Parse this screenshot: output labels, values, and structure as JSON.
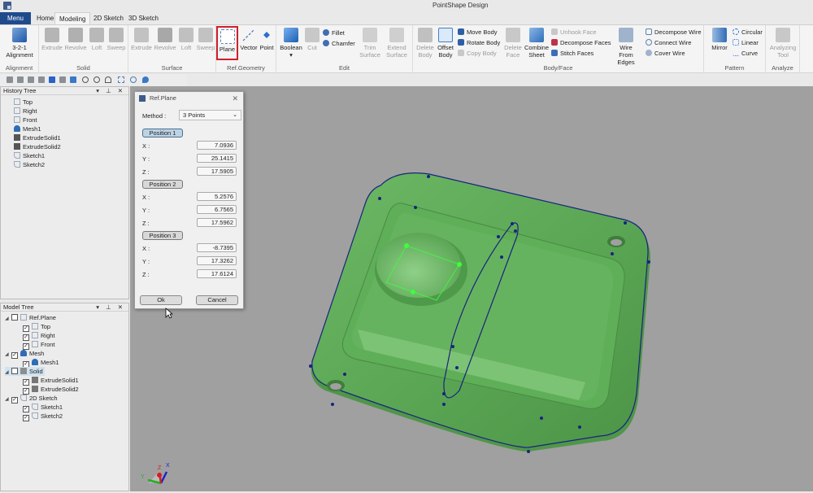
{
  "app": {
    "title": "PointShape Design"
  },
  "tabs": [
    {
      "label": "Menu"
    },
    {
      "label": "Home"
    },
    {
      "label": "Modeling",
      "active": true
    },
    {
      "label": "2D Sketch"
    },
    {
      "label": "3D Sketch"
    }
  ],
  "ribbon": {
    "groups": {
      "alignment": {
        "label": "Alignment",
        "btn": "3-2-1 Alignment"
      },
      "solid": {
        "label": "Solid",
        "items": [
          "Extrude",
          "Revolve",
          "Loft",
          "Sweep"
        ]
      },
      "surface": {
        "label": "Surface",
        "items": [
          "Extrude",
          "Revolve",
          "Loft",
          "Sweep"
        ]
      },
      "refgeom": {
        "label": "Ref.Geometry",
        "items": [
          "Plane",
          "Vector",
          "Point"
        ],
        "selected": "Plane"
      },
      "edit": {
        "label": "Edit",
        "boolean": "Boolean",
        "cut": "Cut",
        "fillet": "Fillet",
        "chamfer": "Chamfer",
        "trim": "Trim Surface",
        "extend": "Extend Surface"
      },
      "bodyface": {
        "label": "Body/Face",
        "delete_body": "Delete Body",
        "offset_body": "Offset Body",
        "move_body": "Move Body",
        "rotate_body": "Rotate Body",
        "copy_body": "Copy Body",
        "delete_face": "Delete Face",
        "combine_sheet": "Combine Sheet",
        "unhook_face": "Unhook Face",
        "decompose_faces": "Decompose Faces",
        "stitch_faces": "Stitch Faces",
        "wire_from_edges": "Wire From Edges",
        "decompose_wire": "Decompose Wire",
        "connect_wire": "Connect Wire",
        "cover_wire": "Cover Wire"
      },
      "pattern": {
        "label": "Pattern",
        "mirror": "Mirror",
        "circular": "Circular",
        "linear": "Linear",
        "curve": "Curve"
      },
      "analyze": {
        "label": "Analyze",
        "tool": "Analyzing Tool"
      }
    }
  },
  "history_tree": {
    "title": "History Tree",
    "items": [
      {
        "label": "Top",
        "icon": "plane-icon"
      },
      {
        "label": "Right",
        "icon": "plane-icon"
      },
      {
        "label": "Front",
        "icon": "plane-icon"
      },
      {
        "label": "Mesh1",
        "icon": "mesh-icon"
      },
      {
        "label": "ExtrudeSolid1",
        "icon": "solid-icon"
      },
      {
        "label": "ExtrudeSolid2",
        "icon": "solid-icon"
      },
      {
        "label": "Sketch1",
        "icon": "sketch-icon"
      },
      {
        "label": "Sketch2",
        "icon": "sketch-icon"
      }
    ]
  },
  "model_tree": {
    "title": "Model Tree",
    "items": [
      {
        "label": "Ref.Plane",
        "level": 0,
        "checked": false
      },
      {
        "label": "Top",
        "level": 1,
        "checked": true
      },
      {
        "label": "Right",
        "level": 1,
        "checked": true
      },
      {
        "label": "Front",
        "level": 1,
        "checked": true
      },
      {
        "label": "Mesh",
        "level": 0,
        "checked": true
      },
      {
        "label": "Mesh1",
        "level": 1,
        "checked": true
      },
      {
        "label": "Solid",
        "level": 0,
        "checked": false,
        "selected": true
      },
      {
        "label": "ExtrudeSolid1",
        "level": 1,
        "checked": true
      },
      {
        "label": "ExtrudeSolid2",
        "level": 1,
        "checked": true
      },
      {
        "label": "2D Sketch",
        "level": 0,
        "checked": true
      },
      {
        "label": "Sketch1",
        "level": 1,
        "checked": true
      },
      {
        "label": "Sketch2",
        "level": 1,
        "checked": true
      }
    ]
  },
  "dialog": {
    "title": "Ref.Plane",
    "method_label": "Method :",
    "method_value": "3 Points",
    "positions": [
      {
        "label": "Position 1",
        "x": "7.0936",
        "y": "25.1415",
        "z": "17.5905"
      },
      {
        "label": "Position 2",
        "x": "5.2576",
        "y": "6.7565",
        "z": "17.5962"
      },
      {
        "label": "Position 3",
        "x": "-8.7395",
        "y": "17.3262",
        "z": "17.6124"
      }
    ],
    "axis_labels": {
      "x": "X :",
      "y": "Y :",
      "z": "Z :"
    },
    "ok": "Ok",
    "cancel": "Cancel"
  },
  "triad": {
    "x": "X",
    "y": "Y",
    "z": "Z"
  },
  "colors": {
    "accent": "#1f4b8c",
    "model": "#5fa85a",
    "wire": "#1a237e",
    "highlight": "#d0202a",
    "plane": "#3dff3d"
  }
}
